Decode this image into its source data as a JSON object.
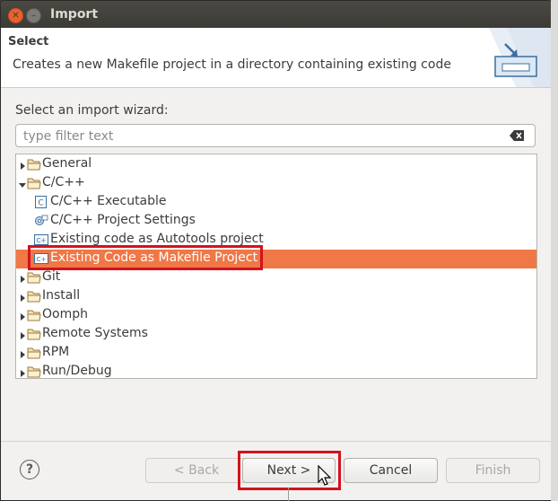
{
  "window": {
    "title": "Import"
  },
  "header": {
    "title": "Select",
    "description": "Creates a new Makefile project in a directory containing existing code",
    "art_icon": "import-wizard-banner-icon"
  },
  "wizard": {
    "label": "Select an import wizard:",
    "filter_placeholder": "type filter text",
    "filter_value": ""
  },
  "tree": {
    "items": [
      {
        "label": "General",
        "type": "folder",
        "expanded": false,
        "level": 0
      },
      {
        "label": "C/C++",
        "type": "folder",
        "expanded": true,
        "level": 0
      },
      {
        "label": "C/C++ Executable",
        "type": "c-exec",
        "level": 1
      },
      {
        "label": "C/C++ Project Settings",
        "type": "settings",
        "level": 1
      },
      {
        "label": "Existing code as Autotools project",
        "type": "c-proj",
        "level": 1
      },
      {
        "label": "Existing Code as Makefile Project",
        "type": "c-proj",
        "level": 1,
        "selected": true
      },
      {
        "label": "Git",
        "type": "folder",
        "expanded": false,
        "level": 0
      },
      {
        "label": "Install",
        "type": "folder",
        "expanded": false,
        "level": 0
      },
      {
        "label": "Oomph",
        "type": "folder",
        "expanded": false,
        "level": 0
      },
      {
        "label": "Remote Systems",
        "type": "folder",
        "expanded": false,
        "level": 0
      },
      {
        "label": "RPM",
        "type": "folder",
        "expanded": false,
        "level": 0
      },
      {
        "label": "Run/Debug",
        "type": "folder",
        "expanded": false,
        "level": 0
      }
    ]
  },
  "buttons": {
    "help": "?",
    "back": "< Back",
    "next": "Next >",
    "cancel": "Cancel",
    "finish": "Finish"
  },
  "colors": {
    "selection": "#f07746",
    "highlight": "#d4121c",
    "titlebar": "#3c3b37"
  }
}
